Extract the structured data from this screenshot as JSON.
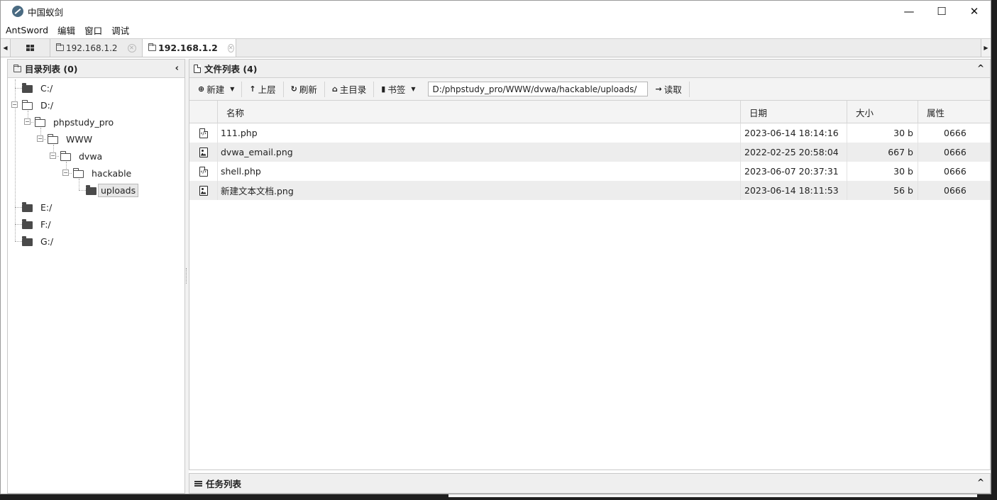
{
  "window": {
    "title": "中国蚁剑",
    "minimize": "—",
    "maximize": "☐",
    "close": "✕"
  },
  "menu": [
    "AntSword",
    "编辑",
    "窗口",
    "调试"
  ],
  "tabs": [
    {
      "label": "192.168.1.2",
      "active": false
    },
    {
      "label": "192.168.1.2",
      "active": true
    }
  ],
  "dir_panel": {
    "title": "目录列表 (0)",
    "collapse_icon": "‹"
  },
  "tree": {
    "c": "C:/",
    "d": "D:/",
    "phpstudy": "phpstudy_pro",
    "www": "WWW",
    "dvwa": "dvwa",
    "hackable": "hackable",
    "uploads": "uploads",
    "e": "E:/",
    "f": "F:/",
    "g": "G:/"
  },
  "file_panel": {
    "title": "文件列表 (4)",
    "collapse_icon": "^"
  },
  "toolbar": {
    "new": "新建",
    "up": "上层",
    "refresh": "刷新",
    "home": "主目录",
    "bookmark": "书签",
    "path": "D:/phpstudy_pro/WWW/dvwa/hackable/uploads/",
    "read": "读取"
  },
  "columns": {
    "name": "名称",
    "date": "日期",
    "size": "大小",
    "perm": "属性"
  },
  "files": [
    {
      "icon": "php-file-icon",
      "name": "111.php",
      "date": "2023-06-14 18:14:16",
      "size": "30 b",
      "perm": "0666"
    },
    {
      "icon": "image-file-icon",
      "name": "dvwa_email.png",
      "date": "2022-02-25 20:58:04",
      "size": "667 b",
      "perm": "0666"
    },
    {
      "icon": "php-file-icon",
      "name": "shell.php",
      "date": "2023-06-07 20:37:31",
      "size": "30 b",
      "perm": "0666"
    },
    {
      "icon": "image-file-icon",
      "name": "新建文本文档.png",
      "date": "2023-06-14 18:11:53",
      "size": "56 b",
      "perm": "0666"
    }
  ],
  "task_panel": {
    "title": "任务列表",
    "expand_icon": "^"
  }
}
